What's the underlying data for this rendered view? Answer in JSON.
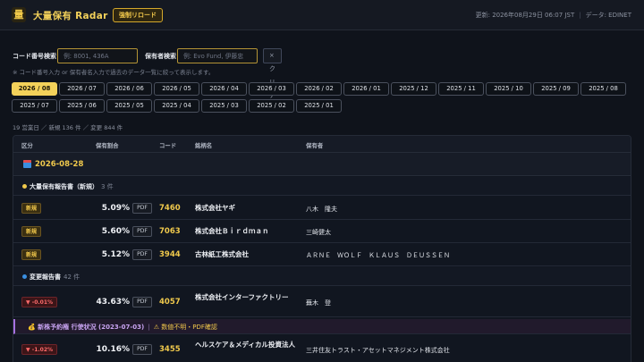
{
  "header": {
    "logo_glyph": "量",
    "title": "大量保有 Radar",
    "reload_label": "強制リロード",
    "updated": "更新: 2026年08月29日 06:07 JST",
    "source": "データ: EDINET"
  },
  "search": {
    "code_label": "コード番号検索",
    "code_placeholder": "例: 8001, 436A",
    "holder_label": "保有者検索",
    "holder_placeholder": "例: Evo Fund, 伊藤忠",
    "clear_label": "× クリア",
    "hint": "※ コード番号入力 or 保有者名入力で過去のデータ一覧に絞って表示します。"
  },
  "months": [
    "2026 / 08",
    "2026 / 07",
    "2026 / 06",
    "2026 / 05",
    "2026 / 04",
    "2026 / 03",
    "2026 / 02",
    "2026 / 01",
    "2025 / 12",
    "2025 / 11",
    "2025 / 10",
    "2025 / 09",
    "2025 / 08",
    "2025 / 07",
    "2025 / 06",
    "2025 / 05",
    "2025 / 04",
    "2025 / 03",
    "2025 / 02",
    "2025 / 01"
  ],
  "active_month": "2026 / 08",
  "summary": "19 営業日 ／ 新規 136 件 ／ 変更 844 件",
  "table": {
    "columns": [
      "区分",
      "保有割合",
      "コード",
      "銘柄名",
      "保有者"
    ],
    "date": "2026-08-28",
    "sections": {
      "new": {
        "label": "大量保有報告書（新規）",
        "count": "3 件",
        "color": "#f0c94c"
      },
      "change": {
        "label": "変更報告書",
        "count": "42 件",
        "color": "#3a8fe0"
      }
    },
    "rows": [
      {
        "badge": "新規",
        "ratio": "5.09%",
        "pdf": "PDF",
        "code": "7460",
        "issuer": "株式会社ヤギ",
        "holder": "八木　隆夫"
      },
      {
        "badge": "新規",
        "ratio": "5.60%",
        "pdf": "PDF",
        "code": "7063",
        "issuer": "株式会社Ｂｉｒｄｍａｎ",
        "holder": "三崎健太"
      },
      {
        "badge": "新規",
        "ratio": "5.12%",
        "pdf": "PDF",
        "code": "3944",
        "issuer": "古林紙工株式会社",
        "holder": "ＡＲＮＥ　ＷＯＬＦ　ＫＬＡＵＳ　ＤＥＵＳＳＥＮ"
      },
      {
        "badge": "▼ -0.01%",
        "ratio": "43.63%",
        "pdf": "PDF",
        "code": "4057",
        "issuer": "株式会社インターファクトリー",
        "holder": "蕪木　登"
      },
      {
        "badge": "▼ -1.02%",
        "ratio": "10.16%",
        "pdf": "PDF",
        "code": "3455",
        "issuer": "ヘルスケア＆メディカル投資法人",
        "holder": "三井住友トラスト・アセットマネジメント株式会社"
      }
    ],
    "note": {
      "icon": "💰",
      "text": "新株予約権 行使状況 (2023-07-03)",
      "sep": "|",
      "warn": "⚠ 数値不明・PDF確認"
    }
  }
}
